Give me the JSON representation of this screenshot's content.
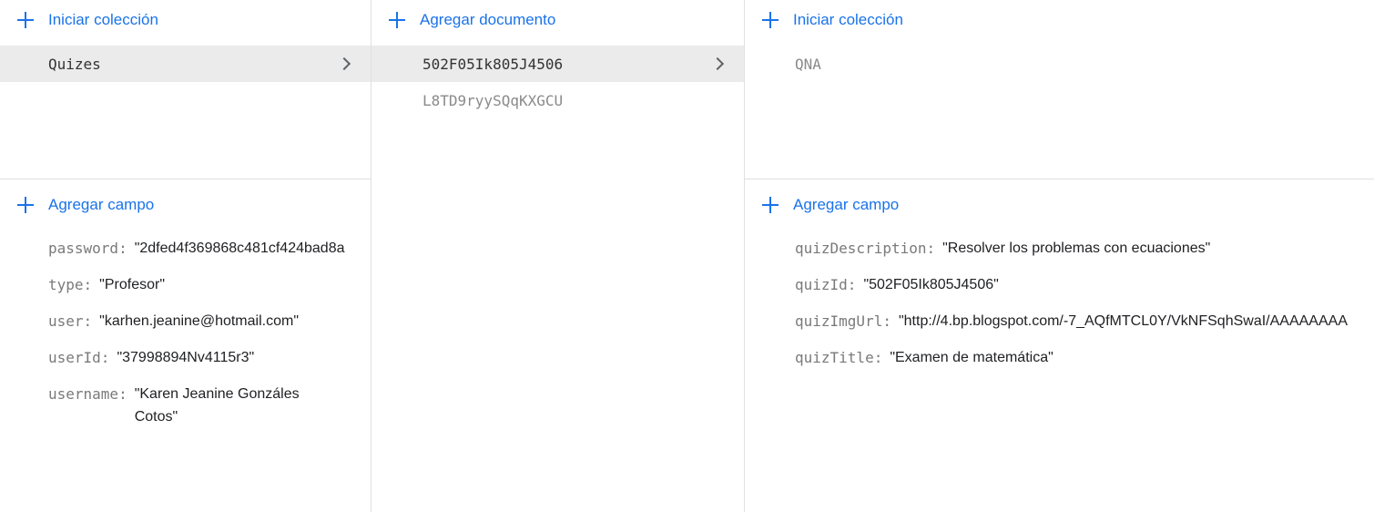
{
  "col1": {
    "add_collection": "Iniciar colección",
    "collections": [
      {
        "name": "Quizes",
        "selected": true
      }
    ],
    "add_field": "Agregar campo",
    "fields": [
      {
        "key": "password:",
        "value": "\"2dfed4f369868c481cf424bad8a"
      },
      {
        "key": "type:",
        "value": "\"Profesor\""
      },
      {
        "key": "user:",
        "value": "\"karhen.jeanine@hotmail.com\""
      },
      {
        "key": "userId:",
        "value": "\"37998894Nv4115r3\""
      },
      {
        "key": "username:",
        "value": "\"Karen Jeanine Gonzáles Cotos\""
      }
    ]
  },
  "col2": {
    "add_document": "Agregar documento",
    "documents": [
      {
        "id": "502F05Ik805J4506",
        "selected": true
      },
      {
        "id": "L8TD9ryySQqKXGCU",
        "selected": false
      }
    ]
  },
  "col3": {
    "add_collection": "Iniciar colección",
    "collections": [
      {
        "name": "QNA",
        "selected": false
      }
    ],
    "add_field": "Agregar campo",
    "fields": [
      {
        "key": "quizDescription:",
        "value": "\"Resolver los problemas con ecuaciones\""
      },
      {
        "key": "quizId:",
        "value": "\"502F05Ik805J4506\""
      },
      {
        "key": "quizImgUrl:",
        "value": "\"http://4.bp.blogspot.com/-7_AQfMTCL0Y/VkNFSqhSwaI/AAAAAAAA"
      },
      {
        "key": "quizTitle:",
        "value": "\"Examen de matemática\""
      }
    ]
  }
}
